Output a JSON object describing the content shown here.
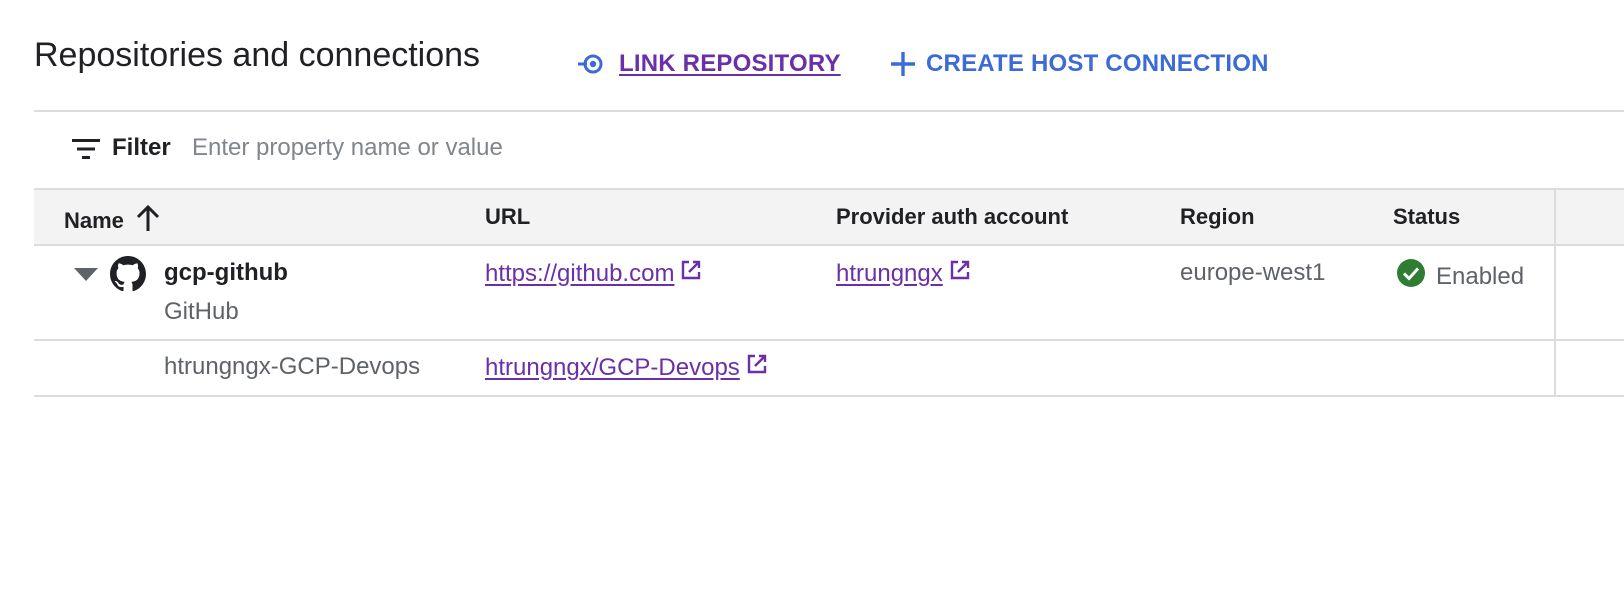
{
  "header": {
    "title": "Repositories and connections",
    "link_repository_label": "LINK REPOSITORY",
    "create_host_connection_label": "CREATE HOST CONNECTION",
    "accent_color": "#3c6bd6"
  },
  "filter": {
    "label": "Filter",
    "placeholder": "Enter property name or value",
    "value": ""
  },
  "table": {
    "columns": {
      "name": "Name",
      "url": "URL",
      "provider": "Provider auth account",
      "region": "Region",
      "status": "Status"
    },
    "name_sort": "ascending",
    "connection": {
      "name": "gcp-github",
      "provider_type": "GitHub",
      "url": "https://github.com",
      "provider_account": "htrungngx",
      "region": "europe-west1",
      "status": "Enabled",
      "status_color": "#2e7d32",
      "expanded": true
    },
    "repositories": [
      {
        "name": "htrungngx-GCP-Devops",
        "url": "htrungngx/GCP-Devops"
      }
    ]
  },
  "icons": {
    "link_repository": "link-repo-icon",
    "create_host_connection": "plus-icon",
    "filter": "filter-icon",
    "sort": "arrow-up-icon",
    "expand": "triangle-down-icon",
    "provider": "github-icon",
    "external_link": "external-link-icon",
    "status": "check-circle-icon"
  },
  "link_color": "#6b2fa8"
}
